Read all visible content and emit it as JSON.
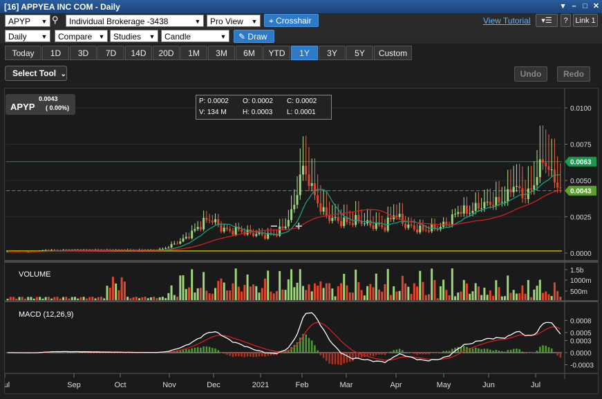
{
  "window": {
    "title": "[16] APPYEA INC COM - Daily",
    "controls": [
      "pin-icon",
      "minimize-icon",
      "restore-icon",
      "close-icon"
    ]
  },
  "toolbar1": {
    "symbol": "APYP",
    "account": "Individual Brokerage -3438",
    "view": "Pro View",
    "crosshair_label": "Crosshair",
    "tutorial_label": "View Tutorial",
    "help_label": "?",
    "link_label": "Link 1"
  },
  "toolbar2": {
    "interval": "Daily",
    "compare": "Compare",
    "studies": "Studies",
    "chart_type": "Candle",
    "draw_label": "Draw"
  },
  "ranges": [
    "Today",
    "1D",
    "3D",
    "7D",
    "14D",
    "20D",
    "1M",
    "3M",
    "6M",
    "YTD",
    "1Y",
    "3Y",
    "5Y",
    "Custom"
  ],
  "active_range": "1Y",
  "select_tool": "Select Tool",
  "undo_label": "Undo",
  "redo_label": "Redo",
  "symbol_box": {
    "symbol": "APYP",
    "price": "0.0043",
    "change": "( 0.00%)"
  },
  "info": {
    "p": "P: 0.0002",
    "o": "O: 0.0002",
    "c": "C: 0.0002",
    "v": "V: 134 M",
    "h": "H: 0.0003",
    "l": "L: 0.0001"
  },
  "chart_data": [
    {
      "type": "candlestick",
      "title": "",
      "x_ticks": [
        "Jul",
        "Sep",
        "Oct",
        "Nov",
        "Dec",
        "2021",
        "Feb",
        "Mar",
        "Apr",
        "May",
        "Jun",
        "Jul"
      ],
      "y_ticks": [
        "0.0100",
        "0.0075",
        "0.0050",
        "0.0025",
        "0.0000"
      ],
      "ylim": [
        0,
        0.01
      ],
      "price_labels": [
        {
          "value": "0.0063",
          "color": "#1a9a50"
        },
        {
          "value": "0.0043",
          "color": "#5aa02c"
        }
      ],
      "close_series": [
        0.0001,
        0.0001,
        0.0001,
        0.0001,
        0.0002,
        0.0002,
        0.0002,
        0.0002,
        0.0002,
        0.0002,
        0.0002,
        0.0002,
        0.0002,
        0.0002,
        0.0002,
        0.0002,
        0.0002,
        0.0003,
        0.0006,
        0.0009,
        0.0014,
        0.002,
        0.0024,
        0.0018,
        0.0015,
        0.0016,
        0.0014,
        0.0013,
        0.0012,
        0.0013,
        0.0018,
        0.003,
        0.006,
        0.0045,
        0.003,
        0.0024,
        0.0022,
        0.0021,
        0.0023,
        0.002,
        0.0019,
        0.0018,
        0.0028,
        0.002,
        0.0017,
        0.0016,
        0.0017,
        0.0018,
        0.0022,
        0.003,
        0.0028,
        0.0032,
        0.0034,
        0.0035,
        0.0037,
        0.0048,
        0.0038,
        0.0045,
        0.0065,
        0.0055,
        0.0043
      ]
    },
    {
      "type": "bar",
      "title": "VOLUME",
      "y_ticks": [
        "1.5b",
        "1000m",
        "500m"
      ]
    },
    {
      "type": "line",
      "title": "MACD (12,26,9)",
      "y_ticks": [
        "0.0008",
        "0.0005",
        "0.0003",
        "0.0000",
        "-0.0003"
      ]
    }
  ]
}
